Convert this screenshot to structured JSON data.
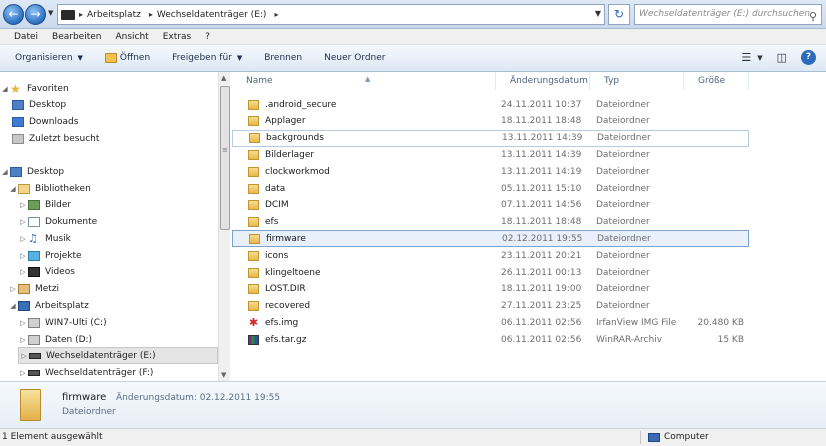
{
  "address_bar": {
    "segments": [
      "Arbeitsplatz",
      "Wechseldatenträger (E:)"
    ],
    "search_placeholder": "Wechseldatenträger (E:) durchsuchen"
  },
  "menu": [
    "Datei",
    "Bearbeiten",
    "Ansicht",
    "Extras",
    "?"
  ],
  "toolbar": {
    "organize": "Organisieren",
    "open": "Öffnen",
    "share": "Freigeben für",
    "burn": "Brennen",
    "new_folder": "Neuer Ordner"
  },
  "nav": {
    "favorites": "Favoriten",
    "fav_items": [
      "Desktop",
      "Downloads",
      "Zuletzt besucht"
    ],
    "desktop": "Desktop",
    "libraries": "Bibliotheken",
    "lib_items": [
      "Bilder",
      "Dokumente",
      "Musik",
      "Projekte",
      "Videos"
    ],
    "user": "Metzi",
    "computer": "Arbeitsplatz",
    "drives": [
      "WIN7-Ulti (C:)",
      "Daten (D:)",
      "Wechseldatenträger (E:)",
      "Wechseldatenträger (F:)"
    ]
  },
  "columns": [
    "Name",
    "Änderungsdatum",
    "Typ",
    "Größe"
  ],
  "files": [
    {
      "name": ".android_secure",
      "date": "24.11.2011 10:37",
      "type": "Dateiordner",
      "size": "",
      "icon": "folder-icon"
    },
    {
      "name": "Applager",
      "date": "18.11.2011 18:48",
      "type": "Dateiordner",
      "size": "",
      "icon": "folder-icon"
    },
    {
      "name": "backgrounds",
      "date": "13.11.2011 14:39",
      "type": "Dateiordner",
      "size": "",
      "icon": "folder-icon"
    },
    {
      "name": "Bilderlager",
      "date": "13.11.2011 14:39",
      "type": "Dateiordner",
      "size": "",
      "icon": "folder-icon"
    },
    {
      "name": "clockworkmod",
      "date": "13.11.2011 14:19",
      "type": "Dateiordner",
      "size": "",
      "icon": "folder-icon"
    },
    {
      "name": "data",
      "date": "05.11.2011 15:10",
      "type": "Dateiordner",
      "size": "",
      "icon": "folder-icon"
    },
    {
      "name": "DCIM",
      "date": "07.11.2011 14:56",
      "type": "Dateiordner",
      "size": "",
      "icon": "folder-icon"
    },
    {
      "name": "efs",
      "date": "18.11.2011 18:48",
      "type": "Dateiordner",
      "size": "",
      "icon": "folder-icon"
    },
    {
      "name": "firmware",
      "date": "02.12.2011 19:55",
      "type": "Dateiordner",
      "size": "",
      "icon": "folder-icon"
    },
    {
      "name": "icons",
      "date": "23.11.2011 20:21",
      "type": "Dateiordner",
      "size": "",
      "icon": "folder-icon"
    },
    {
      "name": "klingeltoene",
      "date": "26.11.2011 00:13",
      "type": "Dateiordner",
      "size": "",
      "icon": "folder-icon"
    },
    {
      "name": "LOST.DIR",
      "date": "18.11.2011 19:00",
      "type": "Dateiordner",
      "size": "",
      "icon": "folder-icon"
    },
    {
      "name": "recovered",
      "date": "27.11.2011 23:25",
      "type": "Dateiordner",
      "size": "",
      "icon": "folder-icon"
    },
    {
      "name": "efs.img",
      "date": "06.11.2011 02:56",
      "type": "IrfanView IMG File",
      "size": "20.480 KB",
      "icon": "irfanview-icon"
    },
    {
      "name": "efs.tar.gz",
      "date": "06.11.2011 02:56",
      "type": "WinRAR-Archiv",
      "size": "15 KB",
      "icon": "winrar-icon"
    }
  ],
  "details": {
    "name": "firmware",
    "label": "Änderungsdatum: 02.12.2011 19:55",
    "type": "Dateiordner"
  },
  "status": {
    "selection": "1 Element ausgewählt",
    "location": "Computer"
  }
}
